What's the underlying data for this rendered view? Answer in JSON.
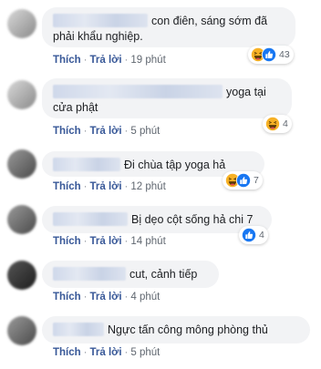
{
  "comments": [
    {
      "text": "con điên, sáng sớm đã phải khẩu nghiệp.",
      "like_label": "Thích",
      "reply_label": "Trả lời",
      "time": "19 phút",
      "reaction_count": "43",
      "reaction_icons": [
        "haha-icon",
        "like-icon"
      ]
    },
    {
      "text": "yoga tại cửa phật",
      "like_label": "Thích",
      "reply_label": "Trả lời",
      "time": "5 phút",
      "reaction_count": "4",
      "reaction_icons": [
        "haha-icon"
      ]
    },
    {
      "text": "Đi chùa tập yoga hả",
      "like_label": "Thích",
      "reply_label": "Trả lời",
      "time": "12 phút",
      "reaction_count": "7",
      "reaction_icons": [
        "haha-icon",
        "like-icon"
      ]
    },
    {
      "text": "Bị dẹo cột sống hả chi 7",
      "like_label": "Thích",
      "reply_label": "Trả lời",
      "time": "14 phút",
      "reaction_count": "4",
      "reaction_icons": [
        "like-icon"
      ]
    },
    {
      "text": "cut, cảnh tiếp",
      "like_label": "Thích",
      "reply_label": "Trả lời",
      "time": "4 phút"
    },
    {
      "text": "Ngực tấn công mông phòng thủ",
      "like_label": "Thích",
      "reply_label": "Trả lời",
      "time": "5 phút"
    }
  ],
  "colors": {
    "bubble": "#f2f3f5",
    "link": "#385898",
    "like_blue": "#1877f2",
    "haha_yellow": "#f7b125"
  }
}
